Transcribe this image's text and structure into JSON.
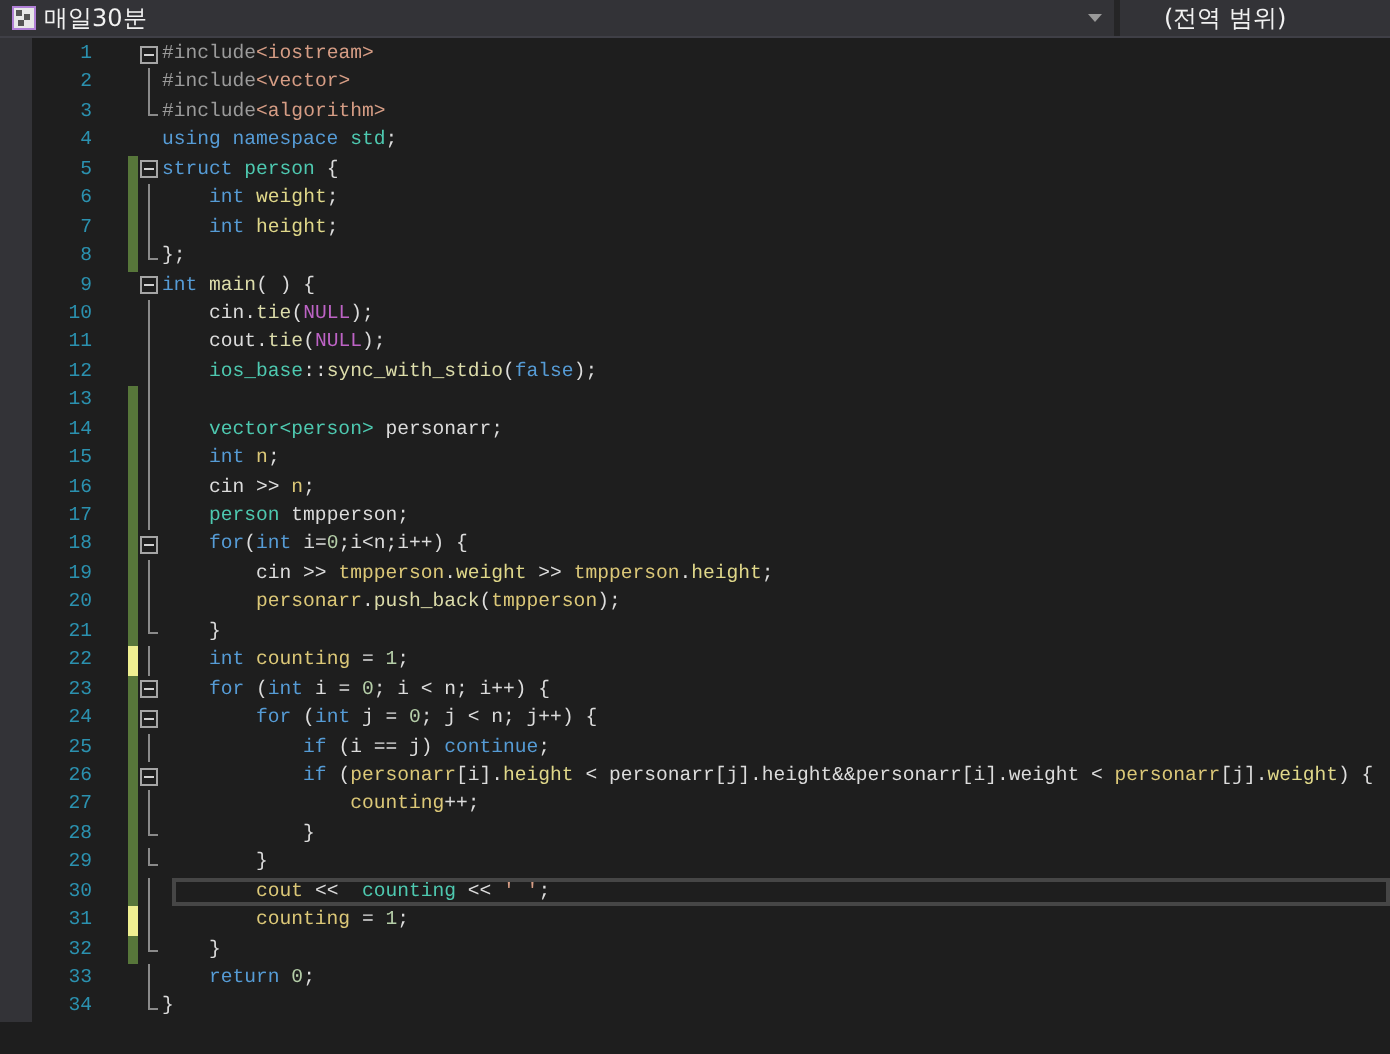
{
  "header": {
    "file_selector": "매일30분",
    "scope_selector": "(전역 범위)"
  },
  "lines": [
    {
      "number": "1",
      "kind": "start",
      "changed": false,
      "unsaved": false,
      "current": false,
      "tokens": [
        {
          "kind": "pp",
          "text": "#include"
        },
        {
          "kind": "inc",
          "text": "<iostream>"
        }
      ]
    },
    {
      "number": "2",
      "kind": "body",
      "changed": false,
      "unsaved": false,
      "current": false,
      "tokens": [
        {
          "kind": "pp",
          "text": "#include"
        },
        {
          "kind": "inc",
          "text": "<vector>"
        }
      ]
    },
    {
      "number": "3",
      "kind": "end",
      "changed": false,
      "unsaved": false,
      "current": false,
      "tokens": [
        {
          "kind": "pp",
          "text": "#include"
        },
        {
          "kind": "inc",
          "text": "<algorithm>"
        }
      ]
    },
    {
      "number": "4",
      "kind": "plain",
      "changed": false,
      "unsaved": false,
      "current": false,
      "tokens": [
        {
          "kind": "kw",
          "text": "using namespace "
        },
        {
          "kind": "ns",
          "text": "std"
        },
        {
          "kind": "op",
          "text": ";"
        }
      ]
    },
    {
      "number": "5",
      "kind": "start",
      "changed": true,
      "unsaved": false,
      "current": false,
      "tokens": [
        {
          "kind": "kw",
          "text": "struct "
        },
        {
          "kind": "type",
          "text": "person"
        },
        {
          "kind": "op",
          "text": " {"
        }
      ]
    },
    {
      "number": "6",
      "kind": "body",
      "changed": true,
      "unsaved": false,
      "current": false,
      "tokens": [
        {
          "kind": "kw",
          "text": "    int "
        },
        {
          "kind": "field",
          "text": "weight"
        },
        {
          "kind": "op",
          "text": ";"
        }
      ]
    },
    {
      "number": "7",
      "kind": "body",
      "changed": true,
      "unsaved": false,
      "current": false,
      "tokens": [
        {
          "kind": "kw",
          "text": "    int "
        },
        {
          "kind": "field",
          "text": "height"
        },
        {
          "kind": "op",
          "text": ";"
        }
      ]
    },
    {
      "number": "8",
      "kind": "end",
      "changed": true,
      "unsaved": false,
      "current": false,
      "tokens": [
        {
          "kind": "op",
          "text": "};"
        }
      ]
    },
    {
      "number": "9",
      "kind": "start",
      "changed": false,
      "unsaved": false,
      "current": false,
      "tokens": [
        {
          "kind": "kw",
          "text": "int "
        },
        {
          "kind": "fn",
          "text": "main"
        },
        {
          "kind": "op",
          "text": "( ) {"
        }
      ]
    },
    {
      "number": "10",
      "kind": "body",
      "changed": false,
      "unsaved": false,
      "current": false,
      "tokens": [
        {
          "kind": "op",
          "text": "    cin."
        },
        {
          "kind": "fn",
          "text": "tie"
        },
        {
          "kind": "op",
          "text": "("
        },
        {
          "kind": "macro",
          "text": "NULL"
        },
        {
          "kind": "op",
          "text": ");"
        }
      ]
    },
    {
      "number": "11",
      "kind": "body",
      "changed": false,
      "unsaved": false,
      "current": false,
      "tokens": [
        {
          "kind": "op",
          "text": "    cout."
        },
        {
          "kind": "fn",
          "text": "tie"
        },
        {
          "kind": "op",
          "text": "("
        },
        {
          "kind": "macro",
          "text": "NULL"
        },
        {
          "kind": "op",
          "text": ");"
        }
      ]
    },
    {
      "number": "12",
      "kind": "body",
      "changed": false,
      "unsaved": false,
      "current": false,
      "tokens": [
        {
          "kind": "type",
          "text": "    ios_base"
        },
        {
          "kind": "op",
          "text": "::"
        },
        {
          "kind": "fn",
          "text": "sync_with_stdio"
        },
        {
          "kind": "op",
          "text": "("
        },
        {
          "kind": "kw",
          "text": "false"
        },
        {
          "kind": "op",
          "text": ");"
        }
      ]
    },
    {
      "number": "13",
      "kind": "body",
      "changed": true,
      "unsaved": false,
      "current": false
    },
    {
      "number": "14",
      "kind": "body",
      "changed": true,
      "unsaved": false,
      "current": false,
      "tokens": [
        {
          "kind": "type",
          "text": "    vector<person>"
        },
        {
          "kind": "op",
          "text": " personarr;"
        }
      ]
    },
    {
      "number": "15",
      "kind": "body",
      "changed": true,
      "unsaved": false,
      "current": false,
      "tokens": [
        {
          "kind": "kw",
          "text": "    int "
        },
        {
          "kind": "local",
          "text": "n"
        },
        {
          "kind": "op",
          "text": ";"
        }
      ]
    },
    {
      "number": "16",
      "kind": "body",
      "changed": true,
      "unsaved": false,
      "current": false,
      "tokens": [
        {
          "kind": "op",
          "text": "    cin >> "
        },
        {
          "kind": "local",
          "text": "n"
        },
        {
          "kind": "op",
          "text": ";"
        }
      ]
    },
    {
      "number": "17",
      "kind": "body",
      "changed": true,
      "unsaved": false,
      "current": false,
      "tokens": [
        {
          "kind": "type",
          "text": "    person"
        },
        {
          "kind": "op",
          "text": " tmpperson;"
        }
      ]
    },
    {
      "number": "18",
      "kind": "start",
      "changed": true,
      "unsaved": false,
      "current": false,
      "tokens": [
        {
          "kind": "kw",
          "text": "    for"
        },
        {
          "kind": "op",
          "text": "("
        },
        {
          "kind": "kw",
          "text": "int "
        },
        {
          "kind": "op",
          "text": "i="
        },
        {
          "kind": "num",
          "text": "0"
        },
        {
          "kind": "op",
          "text": ";i<n;i++) {"
        }
      ]
    },
    {
      "number": "19",
      "kind": "body",
      "changed": true,
      "unsaved": false,
      "current": false,
      "tokens": [
        {
          "kind": "op",
          "text": "        cin >> "
        },
        {
          "kind": "local",
          "text": "tmpperson"
        },
        {
          "kind": "op",
          "text": "."
        },
        {
          "kind": "field",
          "text": "weight"
        },
        {
          "kind": "op",
          "text": " >> "
        },
        {
          "kind": "local",
          "text": "tmpperson"
        },
        {
          "kind": "op",
          "text": "."
        },
        {
          "kind": "field",
          "text": "height"
        },
        {
          "kind": "op",
          "text": ";"
        }
      ]
    },
    {
      "number": "20",
      "kind": "body",
      "changed": true,
      "unsaved": false,
      "current": false,
      "tokens": [
        {
          "kind": "local",
          "text": "        personarr"
        },
        {
          "kind": "op",
          "text": "."
        },
        {
          "kind": "fn",
          "text": "push_back"
        },
        {
          "kind": "op",
          "text": "("
        },
        {
          "kind": "local",
          "text": "tmpperson"
        },
        {
          "kind": "op",
          "text": ");"
        }
      ]
    },
    {
      "number": "21",
      "kind": "end",
      "changed": true,
      "unsaved": false,
      "current": false,
      "tokens": [
        {
          "kind": "op",
          "text": "    }"
        }
      ]
    },
    {
      "number": "22",
      "kind": "body",
      "changed": false,
      "unsaved": true,
      "current": false,
      "tokens": [
        {
          "kind": "kw",
          "text": "    int "
        },
        {
          "kind": "local",
          "text": "counting"
        },
        {
          "kind": "op",
          "text": " = "
        },
        {
          "kind": "num",
          "text": "1"
        },
        {
          "kind": "op",
          "text": ";"
        }
      ]
    },
    {
      "number": "23",
      "kind": "start",
      "changed": true,
      "unsaved": false,
      "current": false,
      "tokens": [
        {
          "kind": "kw",
          "text": "    for"
        },
        {
          "kind": "op",
          "text": " ("
        },
        {
          "kind": "kw",
          "text": "int "
        },
        {
          "kind": "op",
          "text": "i = "
        },
        {
          "kind": "num",
          "text": "0"
        },
        {
          "kind": "op",
          "text": "; i < n; i++) {"
        }
      ]
    },
    {
      "number": "24",
      "kind": "start",
      "changed": true,
      "unsaved": false,
      "current": false,
      "tokens": [
        {
          "kind": "kw",
          "text": "        for"
        },
        {
          "kind": "op",
          "text": " ("
        },
        {
          "kind": "kw",
          "text": "int "
        },
        {
          "kind": "op",
          "text": "j = "
        },
        {
          "kind": "num",
          "text": "0"
        },
        {
          "kind": "op",
          "text": "; j < n; j++) {"
        }
      ]
    },
    {
      "number": "25",
      "kind": "body",
      "changed": true,
      "unsaved": false,
      "current": false,
      "tokens": [
        {
          "kind": "kw",
          "text": "            if"
        },
        {
          "kind": "op",
          "text": " (i == j) "
        },
        {
          "kind": "kw",
          "text": "continue"
        },
        {
          "kind": "op",
          "text": ";"
        }
      ]
    },
    {
      "number": "26",
      "kind": "start",
      "changed": true,
      "unsaved": false,
      "current": false,
      "tokens": [
        {
          "kind": "kw",
          "text": "            if"
        },
        {
          "kind": "op",
          "text": " ("
        },
        {
          "kind": "local",
          "text": "personarr"
        },
        {
          "kind": "op",
          "text": "[i]."
        },
        {
          "kind": "field",
          "text": "height"
        },
        {
          "kind": "op",
          "text": " < personarr[j].height&&personarr[i].weight < "
        },
        {
          "kind": "local",
          "text": "personarr"
        },
        {
          "kind": "op",
          "text": "[j]."
        },
        {
          "kind": "field",
          "text": "weight"
        },
        {
          "kind": "op",
          "text": ") {"
        }
      ]
    },
    {
      "number": "27",
      "kind": "body",
      "changed": true,
      "unsaved": false,
      "current": false,
      "tokens": [
        {
          "kind": "local",
          "text": "                counting"
        },
        {
          "kind": "op",
          "text": "++;"
        }
      ]
    },
    {
      "number": "28",
      "kind": "end",
      "changed": true,
      "unsaved": false,
      "current": false,
      "tokens": [
        {
          "kind": "op",
          "text": "            }"
        }
      ]
    },
    {
      "number": "29",
      "kind": "end",
      "changed": true,
      "unsaved": false,
      "current": false,
      "tokens": [
        {
          "kind": "op",
          "text": "        }"
        }
      ]
    },
    {
      "number": "30",
      "kind": "body",
      "changed": true,
      "unsaved": false,
      "current": true,
      "tokens": [
        {
          "kind": "local",
          "text": "        cout"
        },
        {
          "kind": "op",
          "text": " <<  "
        },
        {
          "kind": "type",
          "text": "counting"
        },
        {
          "kind": "op",
          "text": " << "
        },
        {
          "kind": "str",
          "text": "' '"
        },
        {
          "kind": "op",
          "text": ";"
        }
      ]
    },
    {
      "number": "31",
      "kind": "body",
      "changed": false,
      "unsaved": true,
      "current": false,
      "tokens": [
        {
          "kind": "local",
          "text": "        counting"
        },
        {
          "kind": "op",
          "text": " = "
        },
        {
          "kind": "num",
          "text": "1"
        },
        {
          "kind": "op",
          "text": ";"
        }
      ]
    },
    {
      "number": "32",
      "kind": "end",
      "changed": true,
      "unsaved": false,
      "current": false,
      "tokens": [
        {
          "kind": "op",
          "text": "    }"
        }
      ]
    },
    {
      "number": "33",
      "kind": "body",
      "changed": false,
      "unsaved": false,
      "current": false,
      "tokens": [
        {
          "kind": "kw",
          "text": "    return "
        },
        {
          "kind": "num",
          "text": "0"
        },
        {
          "kind": "op",
          "text": ";"
        }
      ]
    },
    {
      "number": "34",
      "kind": "end",
      "changed": false,
      "unsaved": false,
      "current": false,
      "tokens": [
        {
          "kind": "op",
          "text": "}"
        }
      ]
    }
  ]
}
